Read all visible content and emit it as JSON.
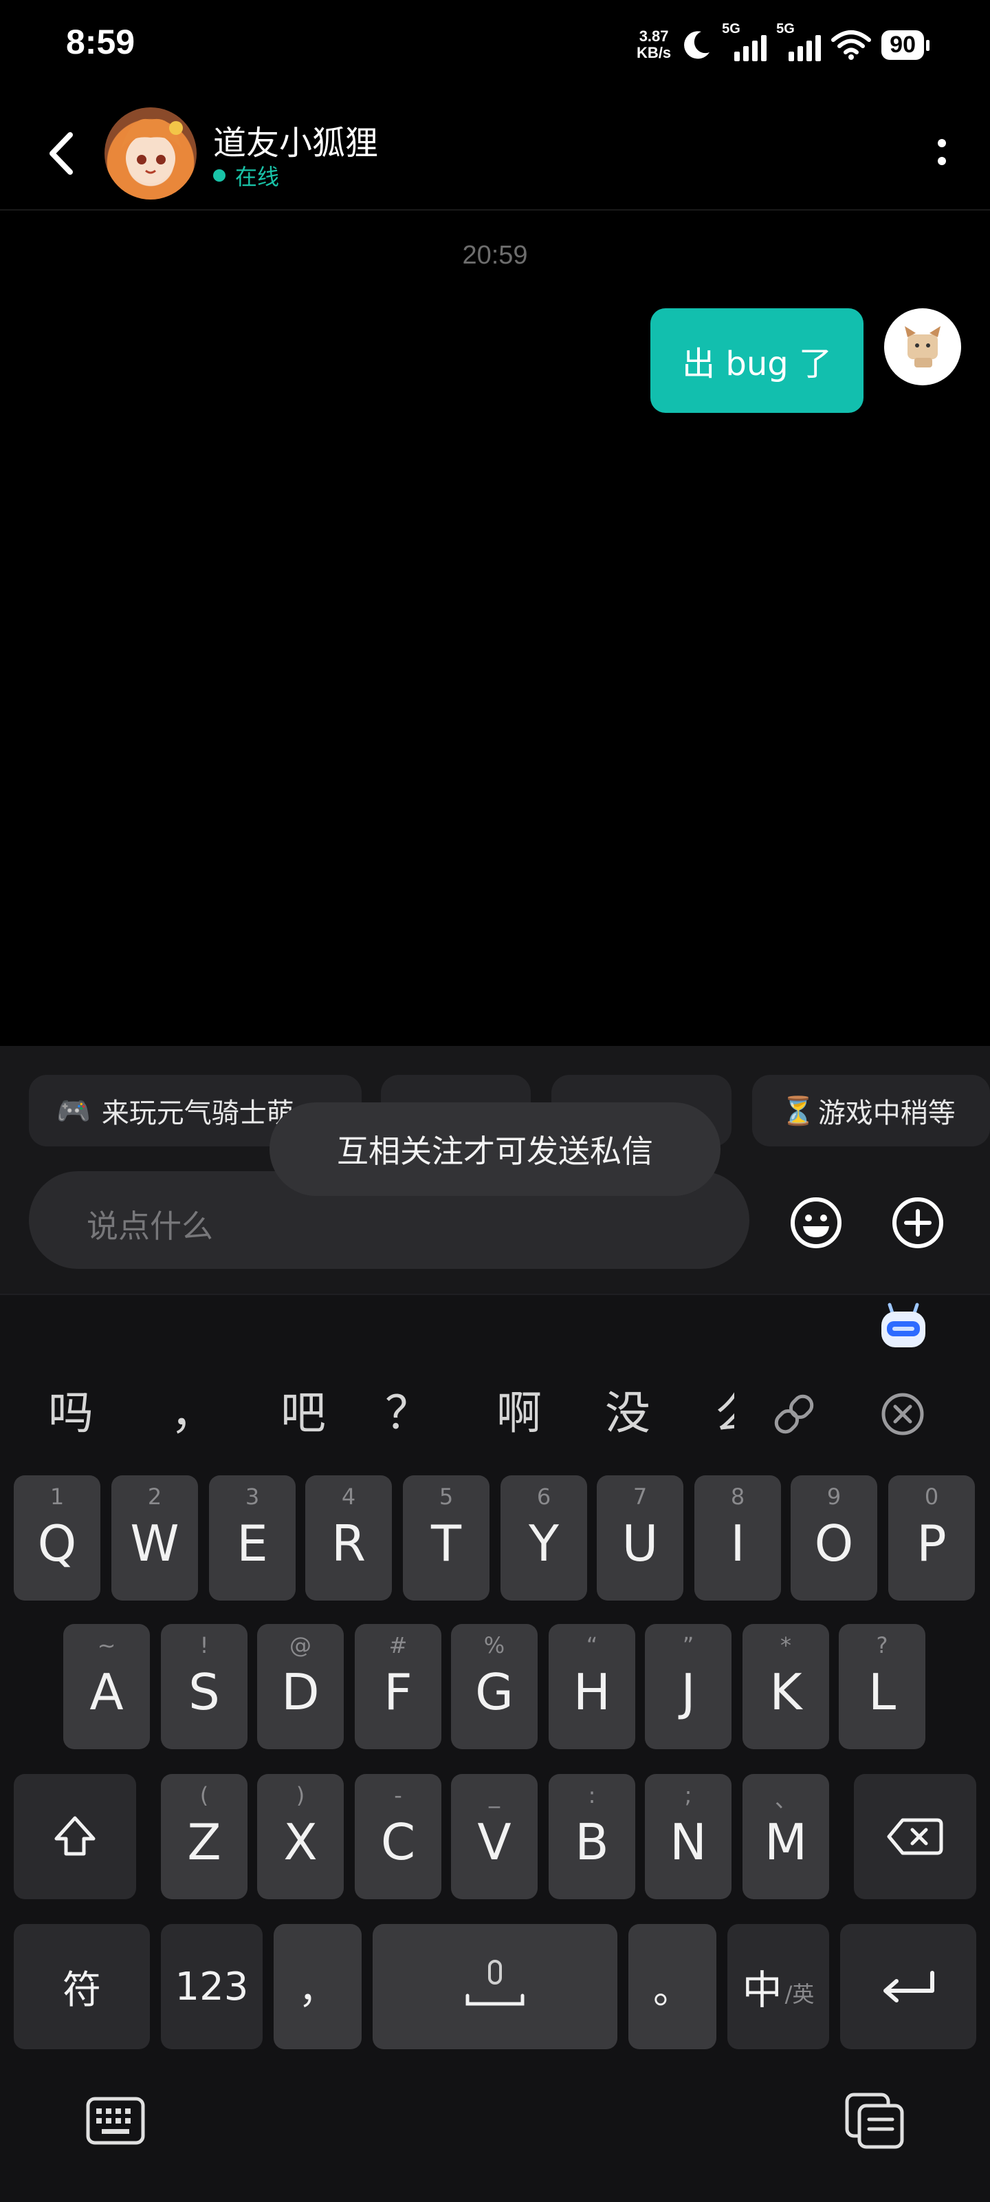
{
  "status_bar": {
    "time": "8:59",
    "net_speed_value": "3.87",
    "net_speed_unit": "KB/s",
    "signal1_label": "5G",
    "signal2_label": "5G",
    "battery": "90"
  },
  "header": {
    "name": "道友小狐狸",
    "status": "在线"
  },
  "chat": {
    "timestamp": "20:59",
    "messages": [
      {
        "from": "me",
        "text": "出 bug 了"
      }
    ]
  },
  "quick_chips": [
    {
      "icon": "🎮",
      "label": "来玩元气骑士萌"
    },
    {
      "icon": "",
      "label": ""
    },
    {
      "icon": "",
      "label": ""
    },
    {
      "icon": "⏳",
      "label": "游戏中稍等"
    }
  ],
  "toast": "互相关注才可发送私信",
  "input": {
    "placeholder": "说点什么"
  },
  "suggestions": [
    "吗",
    "，",
    "吧",
    "？",
    "啊",
    "没",
    "么"
  ],
  "keyboard": {
    "row1": [
      {
        "k": "Q",
        "s": "1"
      },
      {
        "k": "W",
        "s": "2"
      },
      {
        "k": "E",
        "s": "3"
      },
      {
        "k": "R",
        "s": "4"
      },
      {
        "k": "T",
        "s": "5"
      },
      {
        "k": "Y",
        "s": "6"
      },
      {
        "k": "U",
        "s": "7"
      },
      {
        "k": "I",
        "s": "8"
      },
      {
        "k": "O",
        "s": "9"
      },
      {
        "k": "P",
        "s": "0"
      }
    ],
    "row2": [
      {
        "k": "A",
        "s": "~"
      },
      {
        "k": "S",
        "s": "!"
      },
      {
        "k": "D",
        "s": "@"
      },
      {
        "k": "F",
        "s": "#"
      },
      {
        "k": "G",
        "s": "%"
      },
      {
        "k": "H",
        "s": "“"
      },
      {
        "k": "J",
        "s": "”"
      },
      {
        "k": "K",
        "s": "*"
      },
      {
        "k": "L",
        "s": "?"
      }
    ],
    "row3": [
      {
        "k": "Z",
        "s": "("
      },
      {
        "k": "X",
        "s": ")"
      },
      {
        "k": "C",
        "s": "-"
      },
      {
        "k": "V",
        "s": "_"
      },
      {
        "k": "B",
        "s": ":"
      },
      {
        "k": "N",
        "s": ";"
      },
      {
        "k": "M",
        "s": "、"
      }
    ],
    "symbols_label": "符",
    "numbers_label": "123",
    "comma_label": "，",
    "period_label": "。",
    "lang_main": "中",
    "lang_sub": "/英"
  }
}
